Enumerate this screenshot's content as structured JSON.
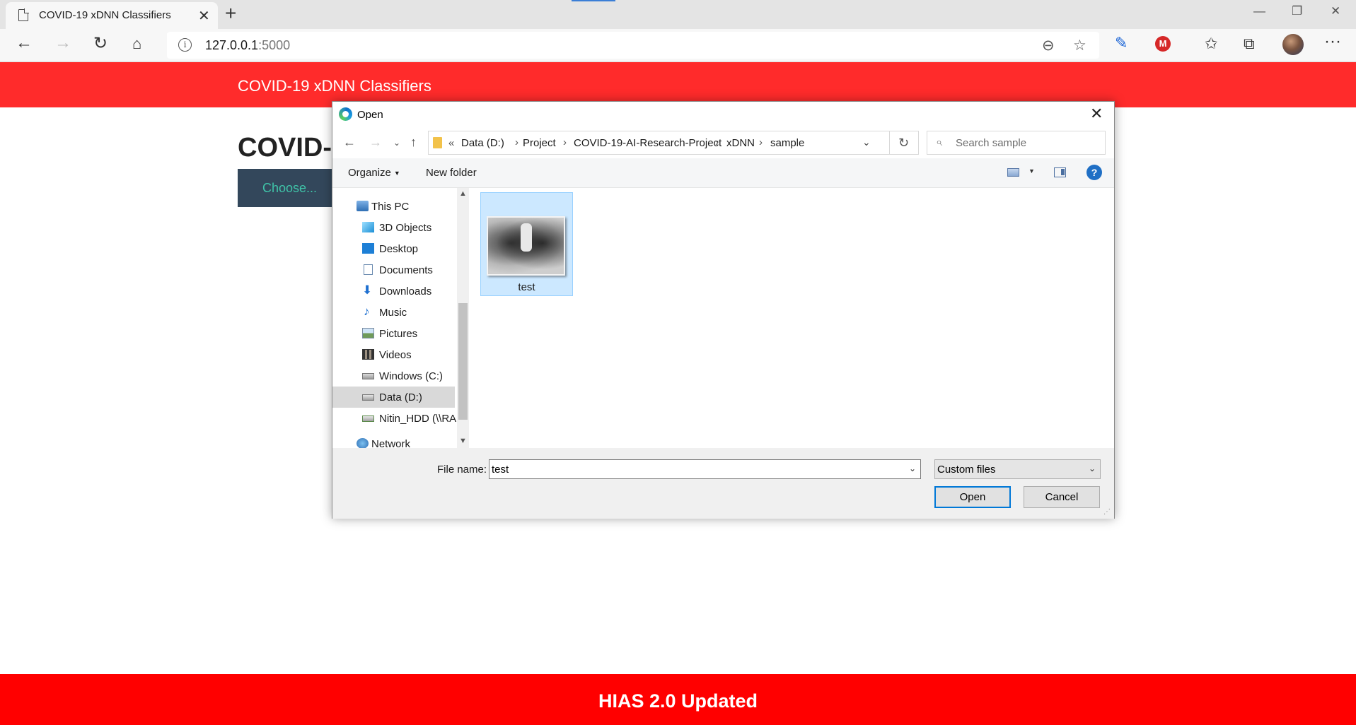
{
  "browser": {
    "tab_title": "COVID-19 xDNN Classifiers",
    "tab_close": "✕",
    "new_tab": "+",
    "address": "127.0.0.1",
    "port": ":5000",
    "window_controls": {
      "minimize": "—",
      "restore": "❐",
      "close": "✕"
    },
    "icons": [
      "back-icon",
      "forward-icon",
      "refresh-icon",
      "home-icon",
      "info-icon",
      "zoom-out-icon",
      "add-favorite-icon",
      "extension-pen-icon",
      "extension-m-icon",
      "favorites-icon",
      "collections-icon",
      "profile-avatar",
      "more-icon"
    ],
    "extension_m_label": "M",
    "more": "···"
  },
  "page": {
    "site_title": "COVID-19 xDNN Classifiers",
    "heading": "COVID-1",
    "choose_button": "Choose...",
    "footer": "HIAS 2.0 Updated",
    "colors": {
      "header": "#ff2b2b",
      "footer": "#ff0000",
      "choose_bg": "#33475b",
      "choose_text": "#3fc3a8"
    }
  },
  "dialog": {
    "title": "Open",
    "close": "✕",
    "breadcrumb": {
      "overflow": "«",
      "items": [
        "Data (D:)",
        "Project",
        "COVID-19-AI-Research-Project",
        "xDNN",
        "sample"
      ]
    },
    "search_placeholder": "Search sample",
    "organize": "Organize",
    "new_folder": "New folder",
    "help": "?",
    "nav_items": [
      {
        "label": "This PC",
        "icon": "this-pc-icon"
      },
      {
        "label": "3D Objects",
        "icon": "3d-objects-icon"
      },
      {
        "label": "Desktop",
        "icon": "desktop-icon"
      },
      {
        "label": "Documents",
        "icon": "documents-icon"
      },
      {
        "label": "Downloads",
        "icon": "downloads-icon"
      },
      {
        "label": "Music",
        "icon": "music-icon"
      },
      {
        "label": "Pictures",
        "icon": "pictures-icon"
      },
      {
        "label": "Videos",
        "icon": "videos-icon"
      },
      {
        "label": "Windows (C:)",
        "icon": "windows-drive-icon"
      },
      {
        "label": "Data (D:)",
        "icon": "drive-icon",
        "selected": true
      },
      {
        "label": "Nitin_HDD (\\\\RA",
        "icon": "network-drive-icon"
      },
      {
        "label": "Network",
        "icon": "network-icon"
      }
    ],
    "files": [
      {
        "name": "test",
        "thumbnail": "ct-scan-thumbnail",
        "selected": true
      }
    ],
    "file_name_label": "File name:",
    "file_name_value": "test",
    "file_type": "Custom files",
    "open_button": "Open",
    "cancel_button": "Cancel"
  }
}
